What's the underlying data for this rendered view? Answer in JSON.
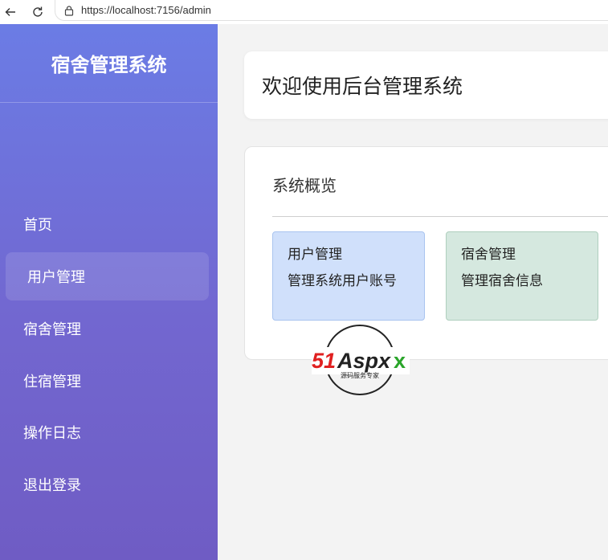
{
  "browser": {
    "url": "https://localhost:7156/admin"
  },
  "sidebar": {
    "brand": "宿舍管理系统",
    "items": [
      {
        "label": "首页"
      },
      {
        "label": "用户管理",
        "active": true
      },
      {
        "label": "宿舍管理"
      },
      {
        "label": "住宿管理"
      },
      {
        "label": "操作日志"
      },
      {
        "label": "退出登录"
      }
    ]
  },
  "main": {
    "welcome": "欢迎使用后台管理系统",
    "overview": {
      "title": "系统概览",
      "tiles": [
        {
          "title": "用户管理",
          "desc": "管理系统用户账号",
          "color": "#d0e0fb"
        },
        {
          "title": "宿舍管理",
          "desc": "管理宿舍信息",
          "color": "#d5e8df"
        }
      ]
    }
  },
  "watermark": {
    "logo": "51Aspx",
    "tagline": "源码服务专家"
  },
  "colors": {
    "sidebar_top": "#6b7ce5",
    "sidebar_bottom": "#6f5cc4",
    "background": "#f3f3f3"
  }
}
